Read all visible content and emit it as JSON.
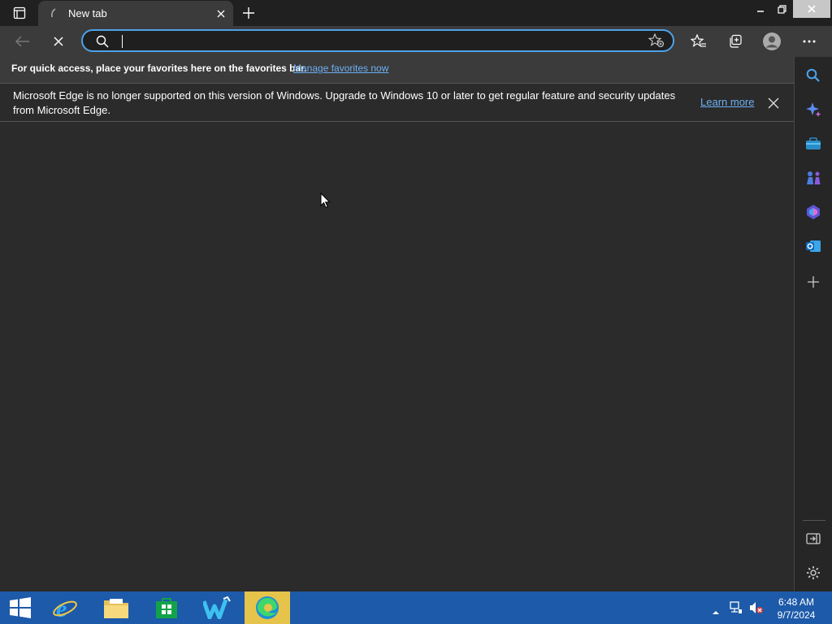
{
  "browser": {
    "tab": {
      "title": "New tab"
    },
    "address_bar": {
      "value": "",
      "placeholder": ""
    },
    "favorites_bar": {
      "message": "For quick access, place your favorites here on the favorites bar.",
      "link": "Manage favorites now"
    },
    "info_bar": {
      "message": "Microsoft Edge is no longer supported on this version of Windows. Upgrade to Windows 10 or later to get regular feature and security updates from Microsoft Edge.",
      "link": "Learn more"
    },
    "sidebar_icons": [
      "search-icon",
      "copilot-icon",
      "shopping-icon",
      "games-icon",
      "microsoft365-icon",
      "outlook-icon",
      "add-icon",
      "hide-sidebar-icon",
      "settings-icon"
    ]
  },
  "taskbar": {
    "apps": [
      "start-button",
      "internet-explorer",
      "file-explorer",
      "store",
      "app-w",
      "microsoft-edge"
    ],
    "active_app": "microsoft-edge",
    "clock": {
      "time": "6:48 AM",
      "date": "9/7/2024"
    }
  },
  "colors": {
    "accent": "#4da2e8",
    "taskbar": "#1d5aa9",
    "active_app": "#e6c34a",
    "link": "#6cb0f5"
  }
}
